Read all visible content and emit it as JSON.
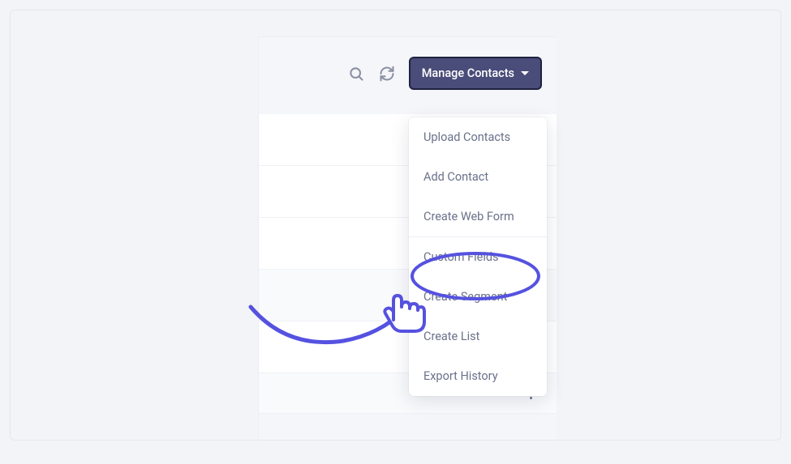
{
  "toolbar": {
    "manage_label": "Manage Contacts"
  },
  "dropdown": {
    "items": [
      {
        "label": "Upload Contacts"
      },
      {
        "label": "Add Contact"
      },
      {
        "label": "Create Web Form"
      },
      {
        "label": "Custom Fields"
      },
      {
        "label": "Create Segment"
      },
      {
        "label": "Create List"
      },
      {
        "label": "Export History"
      }
    ]
  },
  "annotation": {
    "color": "#5552e0"
  }
}
